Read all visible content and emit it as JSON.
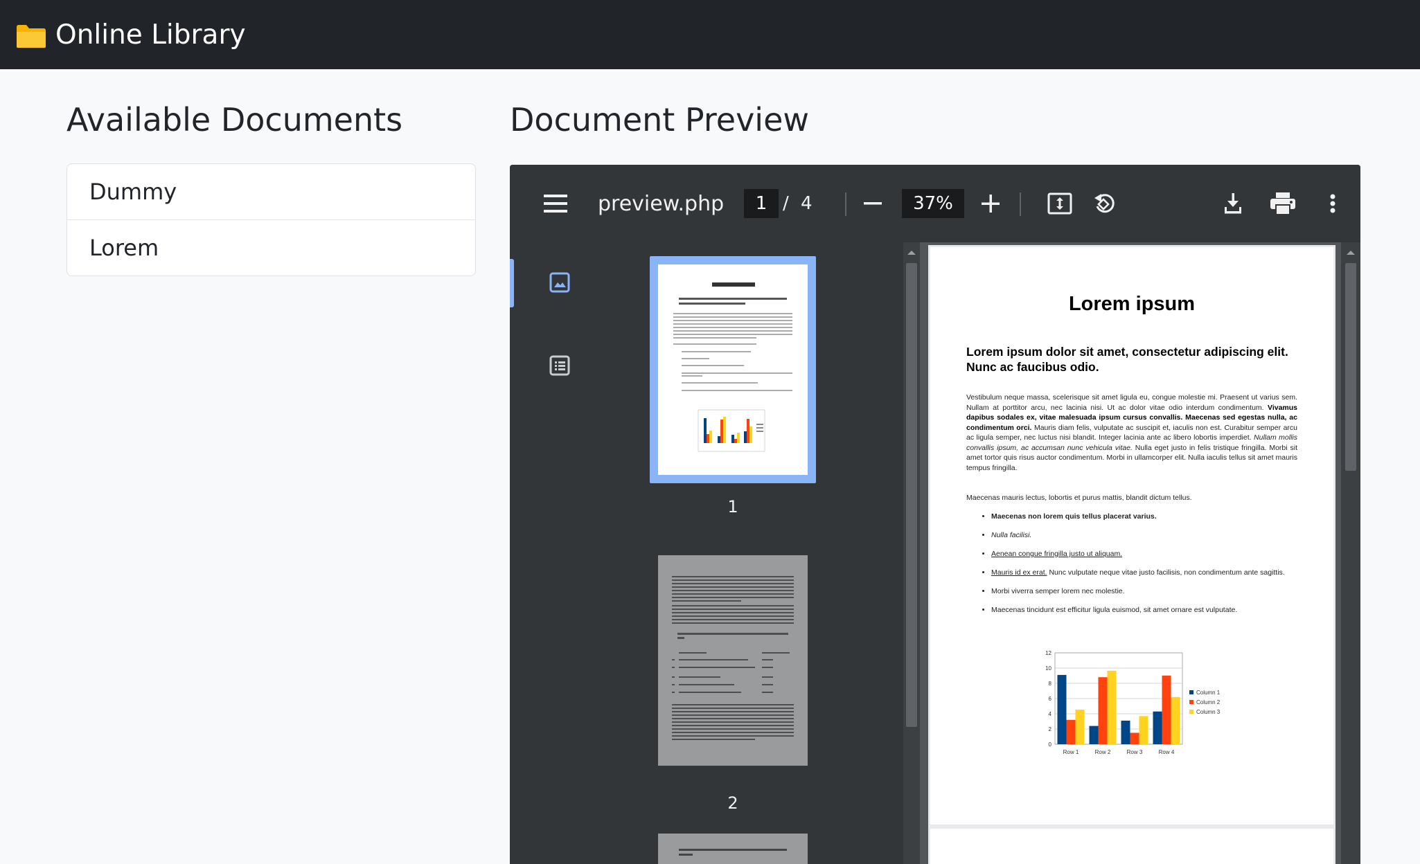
{
  "app": {
    "title": "Online Library",
    "icon": "folder-icon"
  },
  "documents": {
    "heading": "Available Documents",
    "items": [
      {
        "label": "Dummy"
      },
      {
        "label": "Lorem"
      }
    ]
  },
  "preview": {
    "heading": "Document Preview",
    "toolbar": {
      "filename": "preview.php",
      "current_page": "1",
      "page_separator": "/",
      "total_pages": "4",
      "zoom": "37%"
    },
    "thumbnails": [
      {
        "number": "1",
        "selected": true
      },
      {
        "number": "2",
        "selected": false
      }
    ],
    "page": {
      "title": "Lorem ipsum",
      "subtitle": "Lorem ipsum dolor sit amet, consectetur adipiscing elit. Nunc ac faucibus odio.",
      "body_part1": "Vestibulum neque massa, scelerisque sit amet ligula eu, congue molestie mi. Praesent ut varius sem. Nullam at porttitor arcu, nec lacinia nisi. Ut ac dolor vitae odio interdum condimentum. ",
      "body_bold": "Vivamus dapibus sodales ex, vitae malesuada ipsum cursus convallis. Maecenas sed egestas nulla, ac condimentum orci.",
      "body_part2": " Mauris diam felis, vulputate ac suscipit et, iaculis non est. Curabitur semper arcu ac ligula semper, nec luctus nisi blandit. Integer lacinia ante ac libero lobortis imperdiet. ",
      "body_italic": "Nullam mollis convallis ipsum, ac accumsan nunc vehicula vitae.",
      "body_part3": " Nulla eget justo in felis tristique fringilla. Morbi sit amet tortor quis risus auctor condimentum. Morbi in ullamcorper elit. Nulla iaculis tellus sit amet mauris tempus fringilla.",
      "para2": "Maecenas mauris lectus, lobortis et purus mattis, blandit dictum tellus.",
      "list": {
        "item1": "Maecenas non lorem quis tellus placerat varius.",
        "item2": "Nulla facilisi.",
        "item3": "Aenean congue fringilla justo ut aliquam.",
        "item4_link": "Mauris id ex erat.",
        "item4_text": " Nunc vulputate neque vitae justo facilisis, non condimentum ante sagittis.",
        "item5": "Morbi viverra semper lorem nec molestie.",
        "item6": "Maecenas tincidunt est efficitur ligula euismod, sit amet ornare est vulputate."
      }
    }
  },
  "colors": {
    "topbar": "#212529",
    "viewer_toolbar": "#323639",
    "viewer_bg": "#525659",
    "thumb_selected": "#8ab4f8",
    "series1": "#004586",
    "series2": "#ff420e",
    "series3": "#ffd320"
  },
  "chart_data": {
    "type": "bar",
    "categories": [
      "Row 1",
      "Row 2",
      "Row 3",
      "Row 4"
    ],
    "series": [
      {
        "name": "Column 1",
        "values": [
          9.1,
          2.4,
          3.1,
          4.3
        ]
      },
      {
        "name": "Column 2",
        "values": [
          3.2,
          8.8,
          1.5,
          9.02
        ]
      },
      {
        "name": "Column 3",
        "values": [
          4.54,
          9.65,
          3.7,
          6.2
        ]
      }
    ],
    "ylim": [
      0,
      12
    ],
    "yticks": [
      "0",
      "2",
      "4",
      "6",
      "8",
      "10",
      "12"
    ],
    "legend": "right"
  }
}
